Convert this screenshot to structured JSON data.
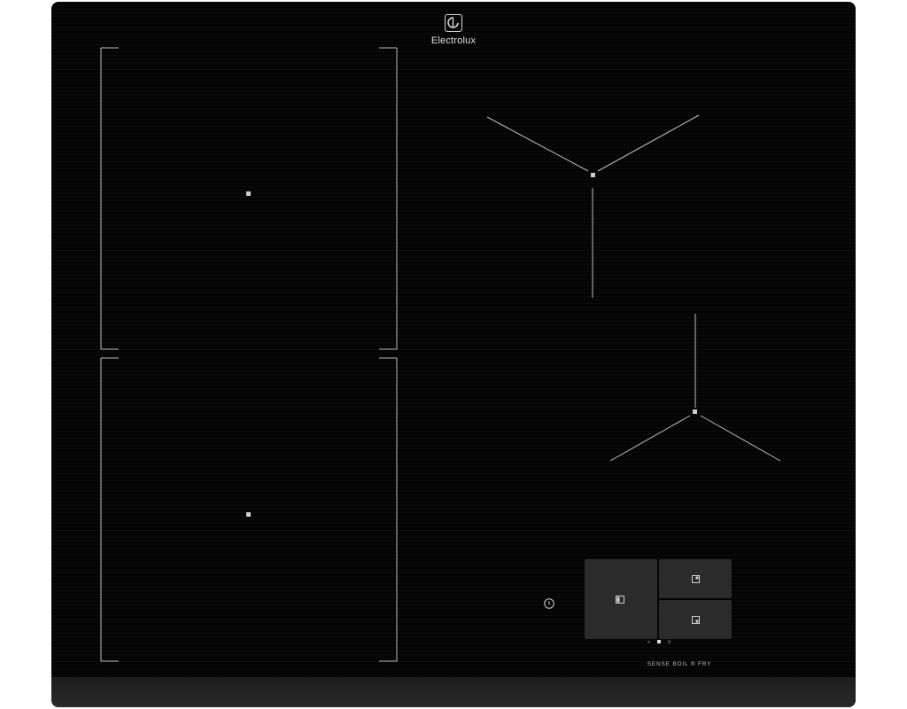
{
  "brand": {
    "name": "Electrolux",
    "icon": "electrolux-logo-icon"
  },
  "controls": {
    "bridge_icon": "bridge-zone-icon",
    "top_zone_icon": "zone-select-icon",
    "bottom_zone_icon": "zone-select-icon",
    "power_icon": "power-icon",
    "feature_label": "SENSE BOIL ® FRY"
  },
  "colors": {
    "glass": "#050505",
    "panel": "#2b2b2b",
    "markings": "#bfbfbf"
  }
}
